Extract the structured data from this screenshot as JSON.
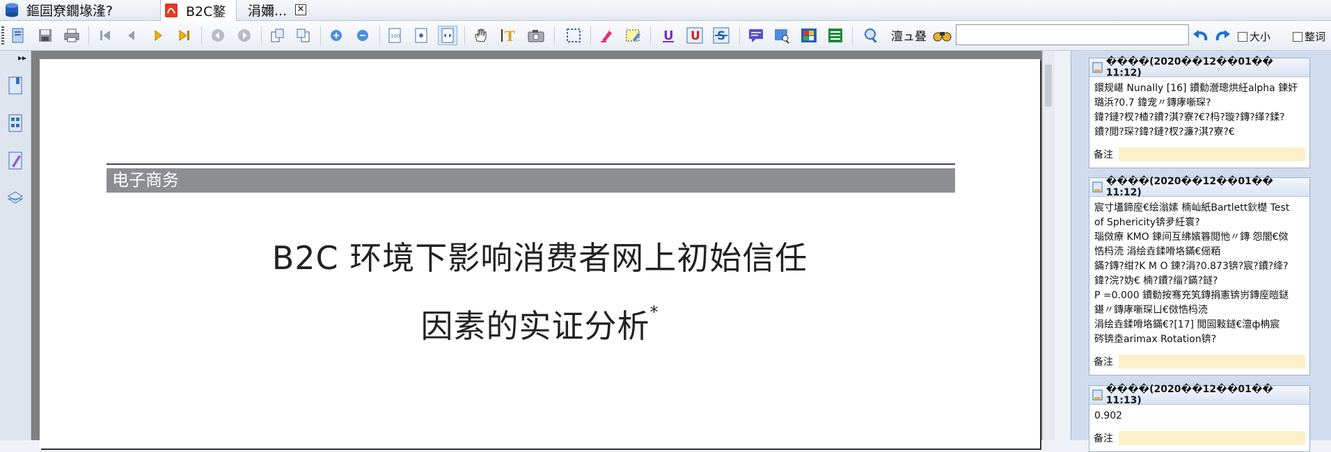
{
  "tabs": [
    {
      "label": "鏂囩尞鐗堟湰?"
    },
    {
      "label": "B2C鐜"
    },
    {
      "label": "涓嬭..."
    }
  ],
  "tab_close": "✕",
  "search": {
    "label": "澶ュ疂",
    "value": ""
  },
  "options": {
    "bigsmall_label": "大小",
    "whole_word_label": "整词"
  },
  "document": {
    "section_band": "电子商务",
    "title_line1": "B2C 环境下影响消费者网上初始信任",
    "title_line2": "因素的实证分析",
    "title_mark": "*"
  },
  "notes": [
    {
      "header": "����(2020��12��01�� 11:12)",
      "lines": [
        "鐶规嵁 Nunally [16] 鐨勬瀯璁烘紝alpha 鍊奸",
        "璐浜?0.7 鍏宠〃鏄庨噺琛?",
        "鍏?鏈?杈?楂?鐨?淇?寮?€?杩?璇?鏄?缂?鍒?",
        "鐨?閲?琛?鍏?鏈?杈?濂?淇?寮?€"
      ],
      "remark_label": "备注"
    },
    {
      "header": "����(2020��12��01�� 11:12)",
      "lines": [
        "宸寸壒鍗庢€绘滃嫊   楠屾紙Bartlett鈥檚 Test",
        "of Sphericity锛夛紝寰?",
        "瑙傚療 KMO 鍊间互绋嬪簭閲忚〃鏄   怨闇€傚",
        "悎杩涜   涓绘垚鍒嗗垎鏋€傜粨",
        "鏋?鏄?绀?K M O 鍊?涓?0.873锛?宸?鐨?绛?",
        "鍏?浣?妫€ 楠?鐨?缁?鏋?鐩?",
        "P =0.000 鐨勬按骞充笂鏄捐憲锛岃鏄庢暟鎹",
        "鍖〃鏄庨噺琛ㄩ€傚悎杩涜",
        "涓绘垚鍒嗗垎鏋€?[17] 閲囩敤鐩€澶ф柟宸",
        "硶锛坴arimax Rotation锛?"
      ],
      "remark_label": "备注"
    },
    {
      "header": "����(2020��12��01�� 11:13)",
      "lines": [
        "0.902"
      ],
      "remark_label": "备注"
    }
  ],
  "colors": {
    "band_gray": "#8d8e92",
    "remark_yellow": "#fbf0c8",
    "doc_background": "#808080"
  },
  "icons": [
    "open-file-icon",
    "save-icon",
    "print-icon",
    "first-page-icon",
    "prev-page-icon",
    "next-page-icon",
    "last-page-icon",
    "back-icon",
    "forward-icon",
    "rotate-left-icon",
    "rotate-right-icon",
    "zoom-in-icon",
    "zoom-out-icon",
    "actual-size-icon",
    "fit-page-icon",
    "fit-width-icon",
    "hand-tool-icon",
    "text-select-icon",
    "snapshot-icon",
    "rect-select-icon",
    "highlight-icon",
    "area-highlight-icon",
    "underline-icon",
    "squiggly-icon",
    "strikeout-icon",
    "note-icon",
    "search-note-icon",
    "color-picker-icon",
    "notes-list-icon",
    "find-icon",
    "binoculars-icon",
    "undo-icon",
    "redo-icon"
  ]
}
